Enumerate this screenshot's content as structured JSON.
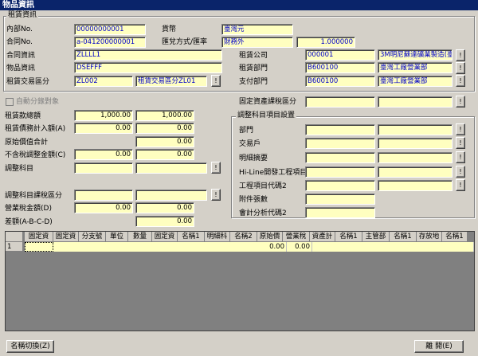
{
  "window": {
    "title": "物品資訊"
  },
  "lease": {
    "group_label": "租賃資訊",
    "internal_no_label": "內部No.",
    "internal_no": "00000000001",
    "currency_label": "貨幣",
    "currency": "臺灣元",
    "contract_no_label": "合同No.",
    "contract_no": "a-041200000001",
    "assessment_label": "匯兌方式/匯率",
    "assessment_method": "財務外",
    "rate": "1.000000",
    "contract_info_label": "合同資訊",
    "contract_info": "ZLLLL1",
    "lessor_label": "租賃公司",
    "lessor_code": "000001",
    "lessor_name": "3M明尼蘇達礦業製造(臺灣)股份有限公司",
    "item_info_label": "物品資訊",
    "item_info": "DSEFFF",
    "lease_dept_label": "租賃部門",
    "lease_dept_code": "B600100",
    "lease_dept_name": "臺灣工廠營業部",
    "trade_class_label": "租賃交易區分",
    "trade_class_code": "ZL002",
    "trade_class_name": "租賃交易區分ZL01",
    "pay_dept_label": "支付部門",
    "pay_dept_code": "B600100",
    "pay_dept_name": "臺灣工廠營業部"
  },
  "auto_split_label": "自動分錄對象",
  "fixed_asset_tax_label": "固定資產課稅區分",
  "amounts": {
    "total_label": "租賃款總額",
    "total_1": "1,000.00",
    "total_2": "1,000.00",
    "debt_label": "租賃債務計入額(A)",
    "debt_1": "0.00",
    "debt_2": "0.00",
    "orig_label": "原始價值合計",
    "orig": "0.00",
    "non_tax_label": "不含稅調整金額(C)",
    "non_tax_1": "0.00",
    "non_tax_2": "0.00",
    "adj_item_label": "調整科目",
    "adj_tax_label": "調整科目課稅區分",
    "vat_label": "營業稅金額(D)",
    "vat_1": "0.00",
    "vat_2": "0.00",
    "diff_label": "差額(A-B-C-D)",
    "diff": "0.00"
  },
  "adj_settings": {
    "group_label": "調整科目項目設置",
    "dept_label": "部門",
    "customer_label": "交易戶",
    "detail_label": "明細摘要",
    "hiline_label": "Hi-Line開發工程項目",
    "project2_label": "工程項目代碼2",
    "attach_label": "附件張數",
    "analysis2_label": "會計分析代碼2"
  },
  "grid": {
    "headers": [
      "固定資",
      "固定資",
      "分支號",
      "單位",
      "數量",
      "固定資",
      "名稱1",
      "明細科",
      "名稱2",
      "原始價",
      "營業稅",
      "資產計",
      "名稱1",
      "主管部",
      "名稱1",
      "存放地",
      "名稱1"
    ],
    "row_no": "1",
    "row_values": {
      "orig": "0.00",
      "vat": "0.00"
    }
  },
  "footer": {
    "switch_label": "名稱切換(Z)",
    "close_label": "離 開(E)"
  },
  "button_glyph": "!"
}
